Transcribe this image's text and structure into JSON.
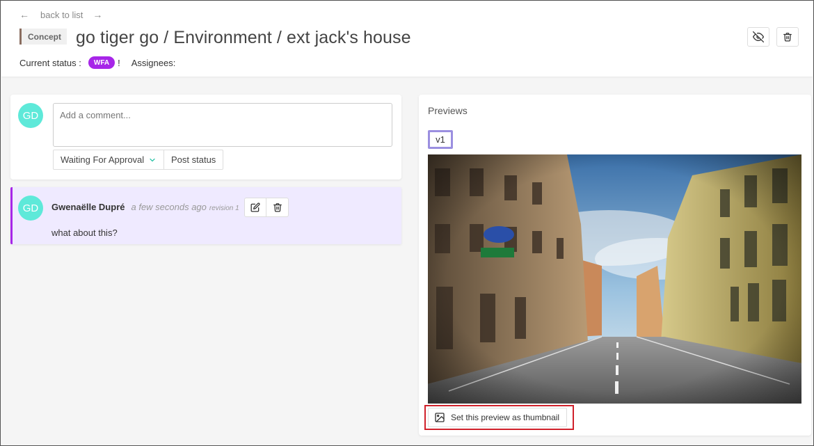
{
  "header": {
    "back_arrow": "←",
    "back_label": "back to list",
    "forward_arrow": "→",
    "entity_type": "Concept",
    "title": "go tiger go / Environment / ext jack's house",
    "status_label": "Current status :",
    "status_badge": "WFA",
    "status_suffix": "!",
    "assignees_label": "Assignees:",
    "actions": [
      {
        "icon": "eye-off-icon"
      },
      {
        "icon": "trash-icon"
      }
    ]
  },
  "new_comment": {
    "avatar_initials": "GD",
    "placeholder": "Add a comment...",
    "status_select_value": "Waiting For Approval",
    "post_label": "Post status"
  },
  "comments": [
    {
      "avatar_initials": "GD",
      "author": "Gwenaëlle Dupré",
      "time": "a few seconds ago",
      "revision": "revision 1",
      "text": "what about this?",
      "status_color": "#a726e8"
    }
  ],
  "previews": {
    "title": "Previews",
    "version_tab": "v1",
    "image_subject": "city street with classical buildings under blue sky",
    "set_thumbnail_label": "Set this preview as thumbnail"
  },
  "colors": {
    "accent_purple": "#a726e8",
    "avatar_teal": "#5ee9d9",
    "comment_bg": "#efeaff",
    "highlight_red": "#d0202a",
    "version_border": "#9b8fe0"
  }
}
